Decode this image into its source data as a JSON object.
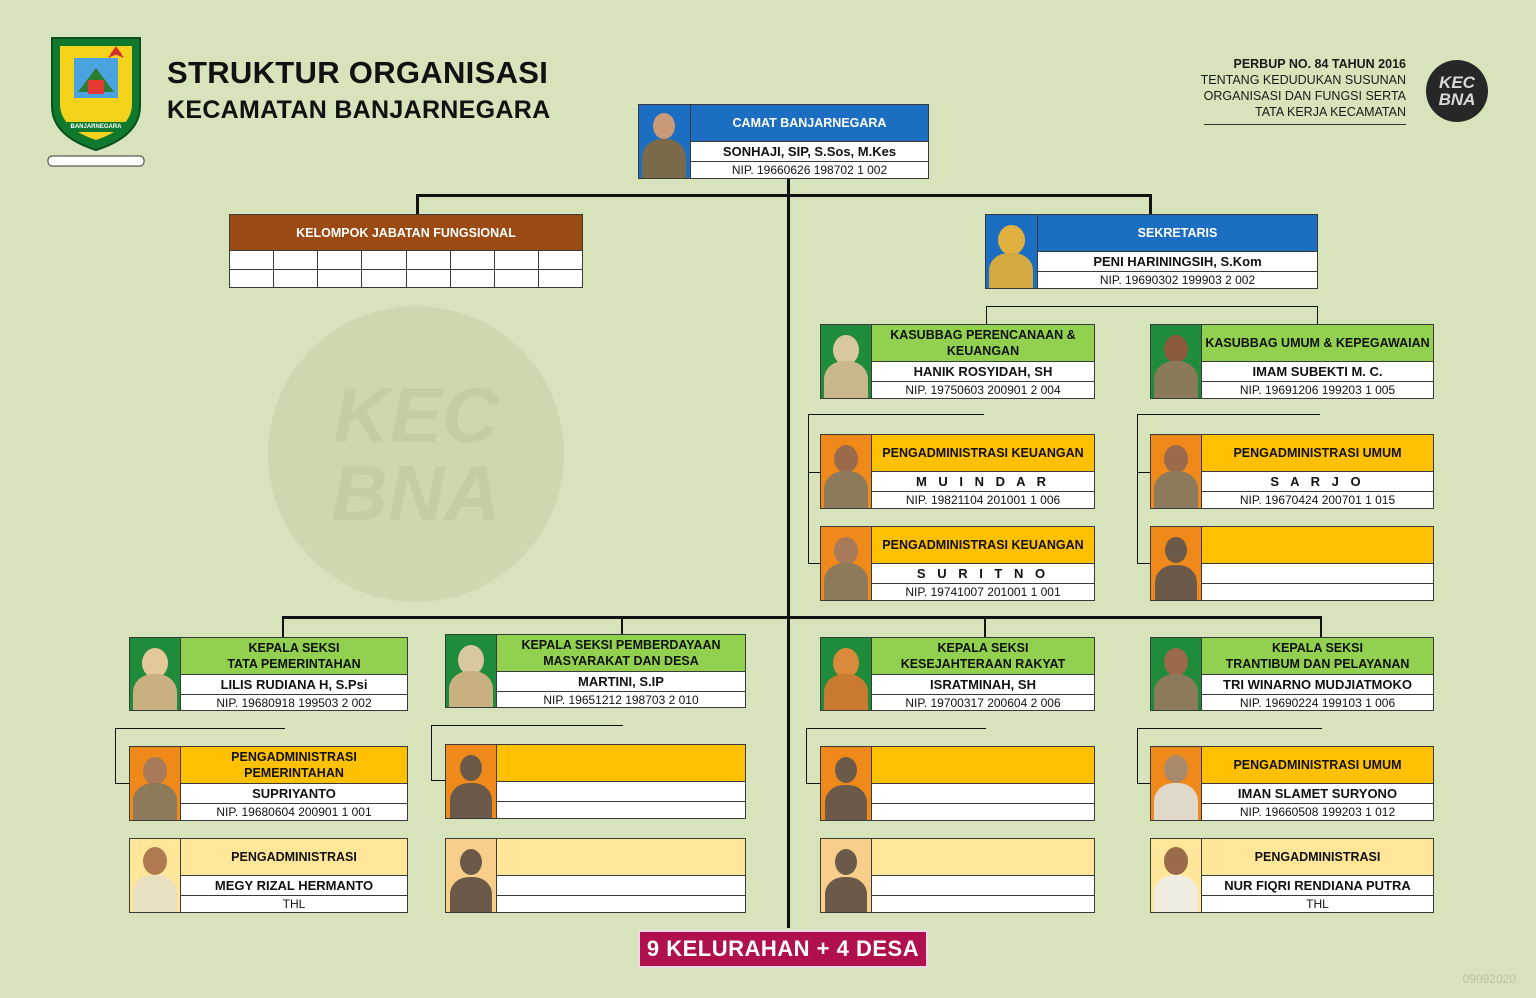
{
  "header": {
    "title_line1": "STRUKTUR ORGANISASI",
    "title_line2": "KECAMATAN BANJARNEGARA",
    "regulation_title": "PERBUP NO. 84 TAHUN 2016",
    "regulation_line1": "TENTANG KEDUDUKAN SUSUNAN",
    "regulation_line2": "ORGANISASI DAN FUNGSI SERTA",
    "regulation_line3": "TATA KERJA KECAMATAN",
    "logo_text": "BANJARNEGARA",
    "badge_line1": "KEC",
    "badge_line2": "BNA"
  },
  "colors": {
    "background": "#d7e3bb",
    "blue": "#1b6ec2",
    "green": "#92d050",
    "orange": "#ffc000",
    "light_yellow": "#ffe699",
    "brown": "#9a4a12",
    "footer": "#b0114e"
  },
  "camat": {
    "title": "CAMAT BANJARNEGARA",
    "name": "SONHAJI, SIP, S.Sos, M.Kes",
    "nip": "NIP. 19660626 198702 1 002"
  },
  "fungsional": {
    "title": "KELOMPOK JABATAN FUNGSIONAL"
  },
  "sekretaris": {
    "title": "SEKRETARIS",
    "name": "PENI HARININGSIH, S.Kom",
    "nip": "NIP. 19690302 199903 2 002"
  },
  "kasubbag_keuangan": {
    "title": "KASUBBAG PERENCANAAN & KEUANGAN",
    "name": "HANIK ROSYIDAH, SH",
    "nip": "NIP. 19750603 200901 2 004"
  },
  "kasubbag_umum": {
    "title": "KASUBBAG UMUM & KEPEGAWAIAN",
    "name": "IMAM SUBEKTI M. C.",
    "nip": "NIP. 19691206 199203 1 005"
  },
  "peng_keu_1": {
    "title": "PENGADMINISTRASI KEUANGAN",
    "name": "M U I N D A R",
    "nip": "NIP. 19821104 201001 1 006"
  },
  "peng_keu_2": {
    "title": "PENGADMINISTRASI KEUANGAN",
    "name": "S U R I T N O",
    "nip": "NIP. 19741007 201001 1 001"
  },
  "peng_umum_1": {
    "title": "PENGADMINISTRASI UMUM",
    "name": "S A R J O",
    "nip": "NIP. 19670424 200701 1 015"
  },
  "seksi_pem": {
    "title_line1": "KEPALA SEKSI",
    "title_line2": "TATA PEMERINTAHAN",
    "name": "LILIS RUDIANA H, S.Psi",
    "nip": "NIP. 19680918 199503 2 002"
  },
  "seksi_pmd": {
    "title_line1": "KEPALA SEKSI PEMBERDAYAAN",
    "title_line2": "MASYARAKAT DAN DESA",
    "name": "MARTINI, S.IP",
    "nip": "NIP. 19651212 198703 2 010"
  },
  "seksi_kesra": {
    "title_line1": "KEPALA SEKSI",
    "title_line2": "KESEJAHTERAAN RAKYAT",
    "name": "ISRATMINAH, SH",
    "nip": "NIP. 19700317 200604 2 006"
  },
  "seksi_trantib": {
    "title_line1": "KEPALA SEKSI",
    "title_line2": "TRANTIBUM DAN PELAYANAN",
    "name": "TRI WINARNO MUDJIATMOKO",
    "nip": "NIP. 19690224 199103 1 006"
  },
  "peng_pem": {
    "title_line1": "PENGADMINISTRASI",
    "title_line2": "PEMERINTAHAN",
    "name": "SUPRIYANTO",
    "nip": "NIP. 19680604 200901 1 001"
  },
  "peng_pem_thl": {
    "title": "PENGADMINISTRASI",
    "name": "MEGY RIZAL HERMANTO",
    "nip": "THL"
  },
  "peng_trantib": {
    "title": "PENGADMINISTRASI UMUM",
    "name": "IMAN SLAMET SURYONO",
    "nip": "NIP. 19660508 199203 1 012"
  },
  "peng_trantib_thl": {
    "title": "PENGADMINISTRASI",
    "name": "NUR FIQRI RENDIANA PUTRA",
    "nip": "THL"
  },
  "footer": {
    "text": "9 KELURAHAN + 4 DESA"
  },
  "image_code": "09092020"
}
